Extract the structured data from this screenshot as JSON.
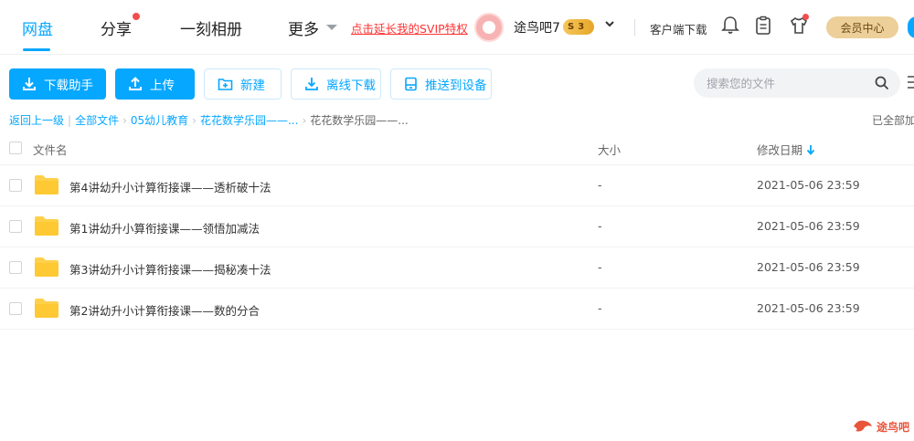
{
  "nav": {
    "tabs": [
      {
        "label": "网盘",
        "active": true
      },
      {
        "label": "分享",
        "active": false
      },
      {
        "label": "一刻相册",
        "active": false
      },
      {
        "label": "更多",
        "active": false
      }
    ],
    "promo": "点击延长我的SVIP特权",
    "username": "途鸟吧7",
    "vip_level": "3",
    "vip_symbol": "S",
    "client_download": "客户端下载",
    "member_center": "会员中心"
  },
  "toolbar": {
    "download_helper": "下载助手",
    "upload": "上传",
    "new_folder": "新建",
    "offline_download": "离线下载",
    "push_to_device": "推送到设备",
    "search_placeholder": "搜索您的文件"
  },
  "breadcrumb": {
    "back": "返回上一级",
    "items": [
      "全部文件",
      "05幼儿教育",
      "花花数学乐园——..."
    ],
    "current": "花花数学乐园——...",
    "loaded_status": "已全部加"
  },
  "table": {
    "columns": {
      "name": "文件名",
      "size": "大小",
      "modified": "修改日期"
    },
    "rows": [
      {
        "name": "第4讲幼升小计算衔接课——透析破十法",
        "size": "-",
        "date": "2021-05-06 23:59"
      },
      {
        "name": "第1讲幼升小算衔接课——领悟加减法",
        "size": "-",
        "date": "2021-05-06 23:59"
      },
      {
        "name": "第3讲幼升小计算衔接课——揭秘凑十法",
        "size": "-",
        "date": "2021-05-06 23:59"
      },
      {
        "name": "第2讲幼升小计算衔接课——数的分合",
        "size": "-",
        "date": "2021-05-06 23:59"
      }
    ]
  },
  "watermark": {
    "text": "途鸟吧"
  },
  "colors": {
    "accent": "#06a7ff",
    "promo": "#ff3333",
    "folder": "#ffd04b",
    "member_gold": "#eccf99"
  }
}
